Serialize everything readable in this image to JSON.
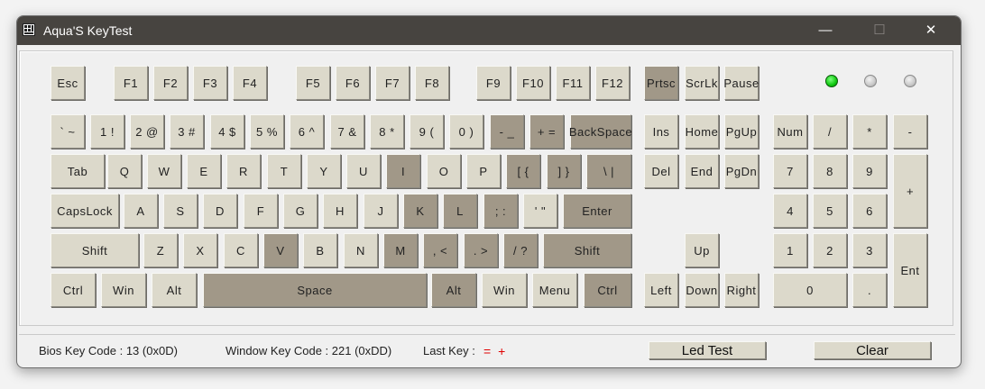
{
  "window": {
    "title": "Aqua'S KeyTest",
    "minimize_glyph": "—",
    "maximize_glyph": "☐",
    "close_glyph": "✕"
  },
  "colors": {
    "key_normal": "#dcd9cb",
    "key_pressed": "#a19888",
    "led_on": "#0fc80f",
    "led_off": "#c8c8c8",
    "last_key_text": "#e00000",
    "titlebar": "#474440"
  },
  "keys": [
    {
      "id": "esc",
      "label": "Esc",
      "pressed": false
    },
    {
      "id": "f1",
      "label": "F1",
      "pressed": false
    },
    {
      "id": "f2",
      "label": "F2",
      "pressed": false
    },
    {
      "id": "f3",
      "label": "F3",
      "pressed": false
    },
    {
      "id": "f4",
      "label": "F4",
      "pressed": false
    },
    {
      "id": "f5",
      "label": "F5",
      "pressed": false
    },
    {
      "id": "f6",
      "label": "F6",
      "pressed": false
    },
    {
      "id": "f7",
      "label": "F7",
      "pressed": false
    },
    {
      "id": "f8",
      "label": "F8",
      "pressed": false
    },
    {
      "id": "f9",
      "label": "F9",
      "pressed": false
    },
    {
      "id": "f10",
      "label": "F10",
      "pressed": false
    },
    {
      "id": "f11",
      "label": "F11",
      "pressed": false
    },
    {
      "id": "f12",
      "label": "F12",
      "pressed": false
    },
    {
      "id": "prtsc",
      "label": "Prtsc",
      "pressed": true
    },
    {
      "id": "scrlk",
      "label": "ScrLk",
      "pressed": false
    },
    {
      "id": "pause",
      "label": "Pause",
      "pressed": false
    },
    {
      "id": "grave",
      "label": "` ~",
      "pressed": false
    },
    {
      "id": "1",
      "label": "1 !",
      "pressed": false
    },
    {
      "id": "2",
      "label": "2 @",
      "pressed": false
    },
    {
      "id": "3",
      "label": "3 #",
      "pressed": false
    },
    {
      "id": "4",
      "label": "4 $",
      "pressed": false
    },
    {
      "id": "5",
      "label": "5 %",
      "pressed": false
    },
    {
      "id": "6",
      "label": "6 ^",
      "pressed": false
    },
    {
      "id": "7",
      "label": "7 &",
      "pressed": false
    },
    {
      "id": "8",
      "label": "8 *",
      "pressed": false
    },
    {
      "id": "9",
      "label": "9 (",
      "pressed": false
    },
    {
      "id": "0",
      "label": "0 )",
      "pressed": false
    },
    {
      "id": "minus",
      "label": "- _",
      "pressed": true
    },
    {
      "id": "equal",
      "label": "+ =",
      "pressed": true
    },
    {
      "id": "backspace",
      "label": "BackSpace",
      "pressed": true
    },
    {
      "id": "ins",
      "label": "Ins",
      "pressed": false
    },
    {
      "id": "home",
      "label": "Home",
      "pressed": false
    },
    {
      "id": "pgup",
      "label": "PgUp",
      "pressed": false
    },
    {
      "id": "num",
      "label": "Num",
      "pressed": false
    },
    {
      "id": "np-div",
      "label": "/",
      "pressed": false
    },
    {
      "id": "np-mul",
      "label": "*",
      "pressed": false
    },
    {
      "id": "np-sub",
      "label": "-",
      "pressed": false
    },
    {
      "id": "tab",
      "label": "Tab",
      "pressed": false
    },
    {
      "id": "q",
      "label": "Q",
      "pressed": false
    },
    {
      "id": "w",
      "label": "W",
      "pressed": false
    },
    {
      "id": "e",
      "label": "E",
      "pressed": false
    },
    {
      "id": "r",
      "label": "R",
      "pressed": false
    },
    {
      "id": "t",
      "label": "T",
      "pressed": false
    },
    {
      "id": "y",
      "label": "Y",
      "pressed": false
    },
    {
      "id": "u",
      "label": "U",
      "pressed": false
    },
    {
      "id": "i",
      "label": "I",
      "pressed": true
    },
    {
      "id": "o",
      "label": "O",
      "pressed": false
    },
    {
      "id": "p",
      "label": "P",
      "pressed": false
    },
    {
      "id": "lbracket",
      "label": "[ {",
      "pressed": true
    },
    {
      "id": "rbracket",
      "label": "] }",
      "pressed": true
    },
    {
      "id": "backslash",
      "label": "\\ |",
      "pressed": true
    },
    {
      "id": "del",
      "label": "Del",
      "pressed": false
    },
    {
      "id": "end",
      "label": "End",
      "pressed": false
    },
    {
      "id": "pgdn",
      "label": "PgDn",
      "pressed": false
    },
    {
      "id": "np7",
      "label": "7",
      "pressed": false
    },
    {
      "id": "np8",
      "label": "8",
      "pressed": false
    },
    {
      "id": "np9",
      "label": "9",
      "pressed": false
    },
    {
      "id": "np-add",
      "label": "+",
      "pressed": false
    },
    {
      "id": "capslock",
      "label": "CapsLock",
      "pressed": false
    },
    {
      "id": "a",
      "label": "A",
      "pressed": false
    },
    {
      "id": "s",
      "label": "S",
      "pressed": false
    },
    {
      "id": "d",
      "label": "D",
      "pressed": false
    },
    {
      "id": "f",
      "label": "F",
      "pressed": false
    },
    {
      "id": "g",
      "label": "G",
      "pressed": false
    },
    {
      "id": "h",
      "label": "H",
      "pressed": false
    },
    {
      "id": "j",
      "label": "J",
      "pressed": false
    },
    {
      "id": "k",
      "label": "K",
      "pressed": true
    },
    {
      "id": "l",
      "label": "L",
      "pressed": true
    },
    {
      "id": "semicolon",
      "label": "; :",
      "pressed": true
    },
    {
      "id": "quote",
      "label": "' \"",
      "pressed": false
    },
    {
      "id": "enter",
      "label": "Enter",
      "pressed": true
    },
    {
      "id": "np4",
      "label": "4",
      "pressed": false
    },
    {
      "id": "np5",
      "label": "5",
      "pressed": false
    },
    {
      "id": "np6",
      "label": "6",
      "pressed": false
    },
    {
      "id": "lshift",
      "label": "Shift",
      "pressed": false
    },
    {
      "id": "z",
      "label": "Z",
      "pressed": false
    },
    {
      "id": "x",
      "label": "X",
      "pressed": false
    },
    {
      "id": "c",
      "label": "C",
      "pressed": false
    },
    {
      "id": "v",
      "label": "V",
      "pressed": true
    },
    {
      "id": "b",
      "label": "B",
      "pressed": false
    },
    {
      "id": "n",
      "label": "N",
      "pressed": false
    },
    {
      "id": "m",
      "label": "M",
      "pressed": true
    },
    {
      "id": "comma",
      "label": ", <",
      "pressed": true
    },
    {
      "id": "period",
      "label": ". >",
      "pressed": true
    },
    {
      "id": "slash",
      "label": "/ ?",
      "pressed": true
    },
    {
      "id": "rshift",
      "label": "Shift",
      "pressed": true
    },
    {
      "id": "up",
      "label": "Up",
      "pressed": false
    },
    {
      "id": "np1",
      "label": "1",
      "pressed": false
    },
    {
      "id": "np2",
      "label": "2",
      "pressed": false
    },
    {
      "id": "np3",
      "label": "3",
      "pressed": false
    },
    {
      "id": "np-enter",
      "label": "Ent",
      "pressed": false
    },
    {
      "id": "lctrl",
      "label": "Ctrl",
      "pressed": false
    },
    {
      "id": "lwin",
      "label": "Win",
      "pressed": false
    },
    {
      "id": "lalt",
      "label": "Alt",
      "pressed": false
    },
    {
      "id": "space",
      "label": "Space",
      "pressed": true
    },
    {
      "id": "ralt",
      "label": "Alt",
      "pressed": true
    },
    {
      "id": "rwin",
      "label": "Win",
      "pressed": false
    },
    {
      "id": "menu",
      "label": "Menu",
      "pressed": false
    },
    {
      "id": "rctrl",
      "label": "Ctrl",
      "pressed": true
    },
    {
      "id": "left",
      "label": "Left",
      "pressed": false
    },
    {
      "id": "down",
      "label": "Down",
      "pressed": false
    },
    {
      "id": "right",
      "label": "Right",
      "pressed": false
    },
    {
      "id": "np0",
      "label": "0",
      "pressed": false
    },
    {
      "id": "np-dot",
      "label": ".",
      "pressed": false
    }
  ],
  "leds": [
    {
      "name": "num-lock",
      "on": true
    },
    {
      "name": "caps-lock",
      "on": false
    },
    {
      "name": "scroll-lock",
      "on": false
    }
  ],
  "status": {
    "bios_key_code": "Bios Key Code : 13 (0x0D)",
    "window_key_code": "Window Key Code : 221 (0xDD)",
    "last_key_label": "Last Key :",
    "last_key_value": "= +",
    "led_test_label": "Led Test",
    "clear_label": "Clear"
  }
}
